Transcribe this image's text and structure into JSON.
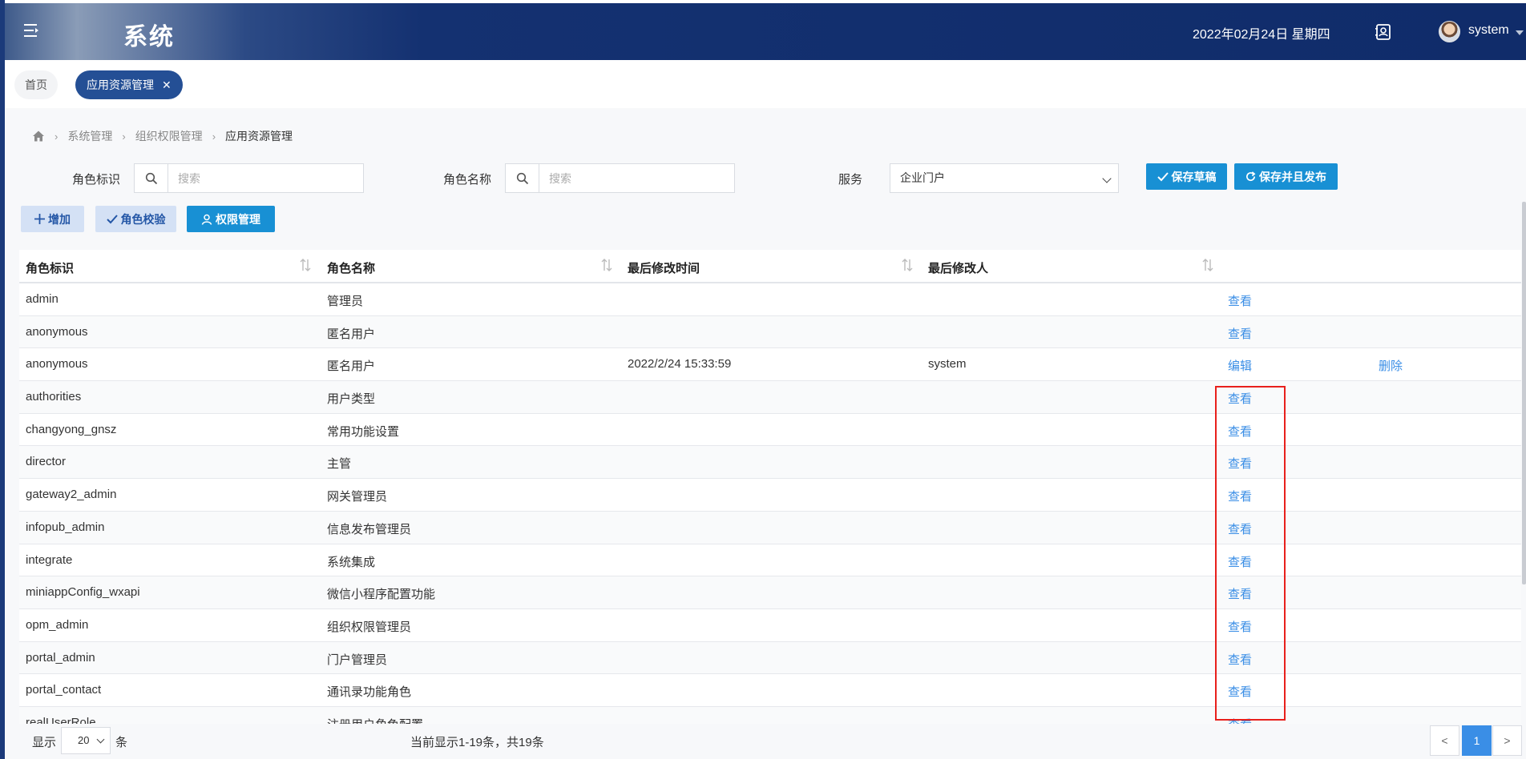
{
  "header": {
    "title": "系统",
    "date": "2022年02月24日 星期四",
    "user": "system"
  },
  "tabs": {
    "home": "首页",
    "active": "应用资源管理"
  },
  "breadcrumb": [
    "系统管理",
    "组织权限管理",
    "应用资源管理"
  ],
  "filters": {
    "role_id_label": "角色标识",
    "role_id_placeholder": "搜索",
    "role_name_label": "角色名称",
    "role_name_placeholder": "搜索",
    "service_label": "服务",
    "service_value": "企业门户"
  },
  "buttons": {
    "save_draft": "保存草稿",
    "save_publish": "保存并且发布",
    "add": "增加",
    "role_check": "角色校验",
    "permission": "权限管理"
  },
  "table": {
    "columns": [
      "角色标识",
      "角色名称",
      "最后修改时间",
      "最后修改人"
    ],
    "rows": [
      {
        "id": "admin",
        "name": "管理员",
        "time": "",
        "user": "",
        "action": "查看",
        "delete": ""
      },
      {
        "id": "anonymous",
        "name": "匿名用户",
        "time": "",
        "user": "",
        "action": "查看",
        "delete": ""
      },
      {
        "id": "anonymous",
        "name": "匿名用户",
        "time": "2022/2/24 15:33:59",
        "user": "system",
        "action": "编辑",
        "delete": "删除"
      },
      {
        "id": "authorities",
        "name": "用户类型",
        "time": "",
        "user": "",
        "action": "查看",
        "delete": ""
      },
      {
        "id": "changyong_gnsz",
        "name": "常用功能设置",
        "time": "",
        "user": "",
        "action": "查看",
        "delete": ""
      },
      {
        "id": "director",
        "name": "主管",
        "time": "",
        "user": "",
        "action": "查看",
        "delete": ""
      },
      {
        "id": "gateway2_admin",
        "name": "网关管理员",
        "time": "",
        "user": "",
        "action": "查看",
        "delete": ""
      },
      {
        "id": "infopub_admin",
        "name": "信息发布管理员",
        "time": "",
        "user": "",
        "action": "查看",
        "delete": ""
      },
      {
        "id": "integrate",
        "name": "系统集成",
        "time": "",
        "user": "",
        "action": "查看",
        "delete": ""
      },
      {
        "id": "miniappConfig_wxapi",
        "name": "微信小程序配置功能",
        "time": "",
        "user": "",
        "action": "查看",
        "delete": ""
      },
      {
        "id": "opm_admin",
        "name": "组织权限管理员",
        "time": "",
        "user": "",
        "action": "查看",
        "delete": ""
      },
      {
        "id": "portal_admin",
        "name": "门户管理员",
        "time": "",
        "user": "",
        "action": "查看",
        "delete": ""
      },
      {
        "id": "portal_contact",
        "name": "通讯录功能角色",
        "time": "",
        "user": "",
        "action": "查看",
        "delete": ""
      },
      {
        "id": "realUserRole",
        "name": "注册用户角色配置",
        "time": "",
        "user": "",
        "action": "查看",
        "delete": ""
      }
    ]
  },
  "footer": {
    "show": "显示",
    "page_size": "20",
    "unit": "条",
    "info": "当前显示1-19条，共19条",
    "prev": "<",
    "page": "1",
    "next": ">"
  }
}
